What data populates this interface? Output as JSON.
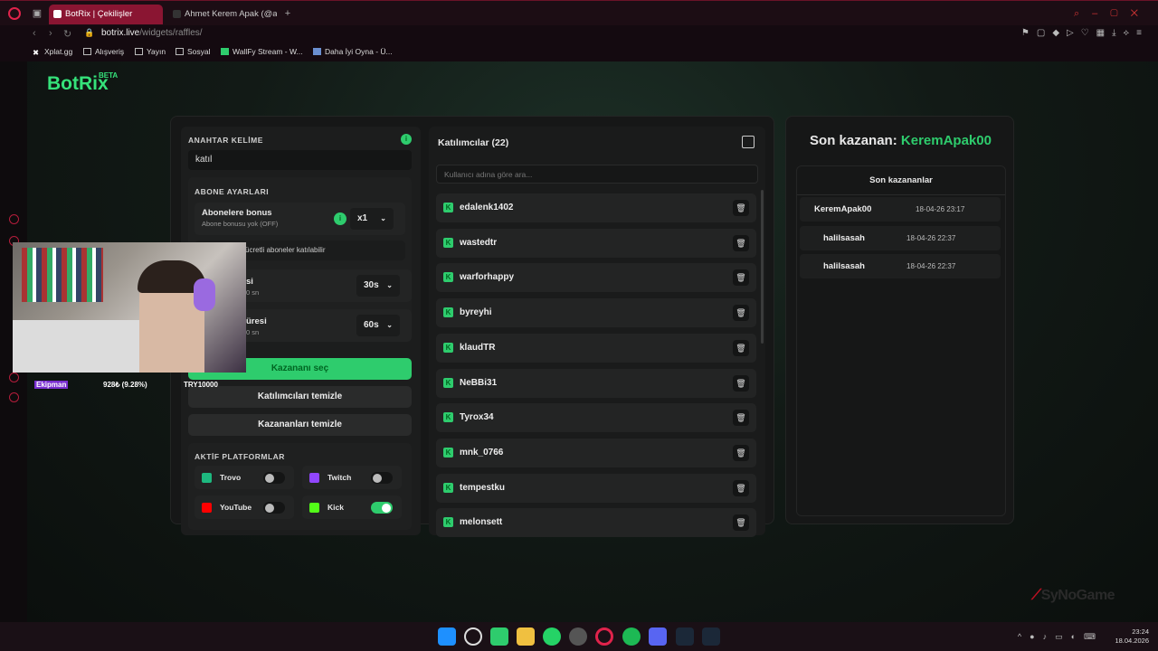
{
  "browser": {
    "tabs": [
      {
        "title": "BotRix | Çekilişler"
      },
      {
        "title": "Ahmet Kerem Apak (@ahm"
      }
    ],
    "url_host": "botrix.live",
    "url_path": "/widgets/raffles/",
    "bookmarks": [
      "Xplat.gg",
      "Alışveriş",
      "Yayın",
      "Sosyal",
      "WallFy Stream - W...",
      "Daha İyi Oyna - Ü..."
    ]
  },
  "app": {
    "logo": "BotRix",
    "logo_badge": "BETA"
  },
  "settings": {
    "keyword_label": "ANAHTAR KELİME",
    "keyword_value": "katıl",
    "sub_settings_label": "ABONE AYARLARI",
    "sub_bonus_title": "Abonelere bonus",
    "sub_bonus_desc": "Abone bonusu yok (OFF)",
    "sub_bonus_mult": "x1",
    "paid_subs_text": "ücretli aboneler katılabilir",
    "timer1_title": "si",
    "timer1_desc": "0 sn",
    "timer1_value": "30s",
    "timer2_title": "üresi",
    "timer2_desc": "0 sn",
    "timer2_value": "60s",
    "pick_winner": "Kazananı seç",
    "clear_participants": "Katılımcıları temizle",
    "clear_winners": "Kazananları temizle",
    "platforms_label": "AKTİF PLATFORMLAR",
    "platforms": [
      {
        "name": "Trovo",
        "enabled": false,
        "color": "#1db87f"
      },
      {
        "name": "Twitch",
        "enabled": false,
        "color": "#9146ff"
      },
      {
        "name": "YouTube",
        "enabled": false,
        "color": "#ff0000"
      },
      {
        "name": "Kick",
        "enabled": true,
        "color": "#53fc18"
      }
    ]
  },
  "participants": {
    "title": "Katılımcılar (22)",
    "search_placeholder": "Kullanıcı adına göre ara...",
    "list": [
      "edalenk1402",
      "wastedtr",
      "warforhappy",
      "byreyhi",
      "klaudTR",
      "NeBBi31",
      "Tyrox34",
      "mnk_0766",
      "tempestku",
      "melonsett"
    ]
  },
  "winners": {
    "headline_prefix": "Son kazanan:",
    "headline_name": "KeremApak00",
    "list_title": "Son kazananlar",
    "list": [
      {
        "name": "KeremApak00",
        "time": "18-04-26 23:17"
      },
      {
        "name": "halilsasah",
        "time": "18-04-26 22:37"
      },
      {
        "name": "halilsasah",
        "time": "18-04-26 22:37"
      }
    ]
  },
  "stream_overlay": {
    "name": "Ekipman",
    "progress": "928₺ (9.28%)",
    "goal": "TRY10000"
  },
  "taskbar": {
    "time": "23:24",
    "date": "18.04.2026"
  },
  "watermark": "SyNoGame",
  "colors": {
    "accent": "#2ecc6d",
    "browser_accent": "#e0234b"
  }
}
